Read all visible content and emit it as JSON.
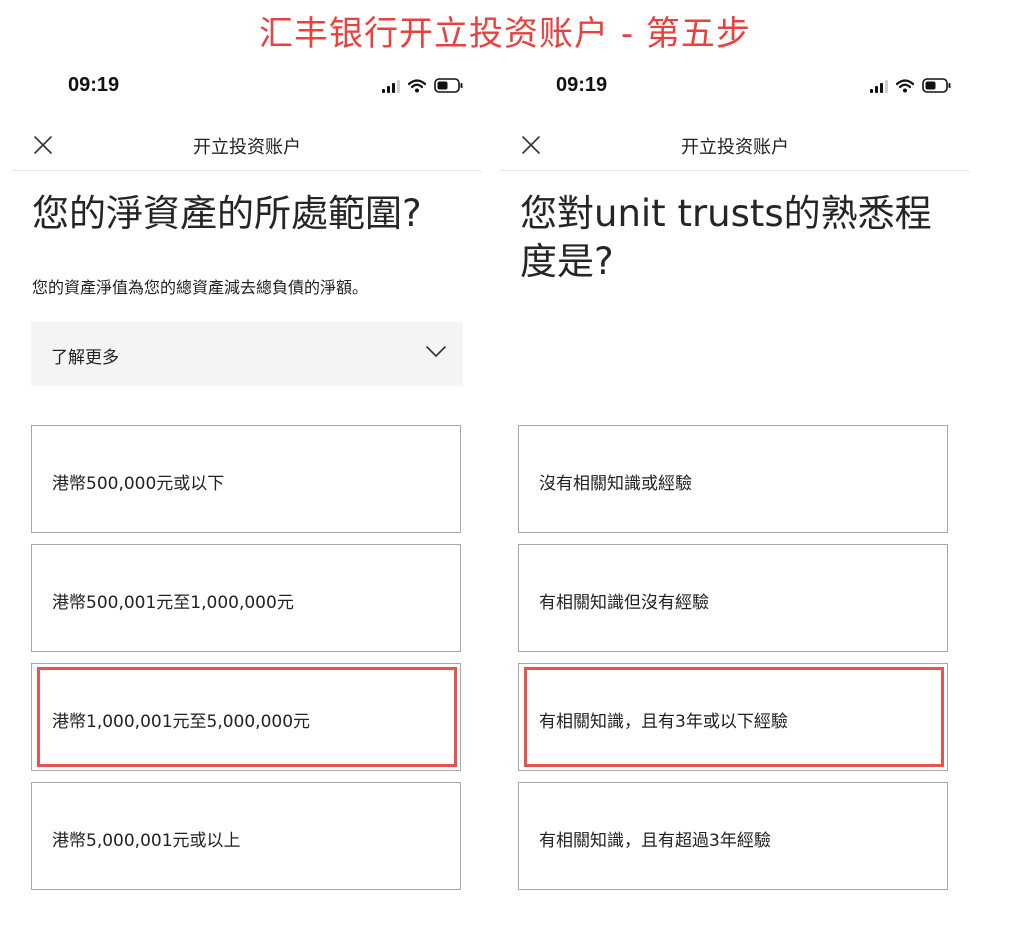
{
  "banner": {
    "title": "汇丰银行开立投资账户 - 第五步"
  },
  "colors": {
    "highlight": "#e8534f",
    "banner": "#e8413e",
    "learn_more_bg": "#f4f4f4"
  },
  "screens": [
    {
      "status": {
        "time": "09:19"
      },
      "nav": {
        "title": "开立投资账户",
        "close_icon": "close-icon"
      },
      "question": "您的淨資產的所處範圍?",
      "subtext": "您的資產淨值為您的總資產減去總負債的淨額。",
      "learn_more": {
        "label": "了解更多",
        "icon": "chevron-down-icon"
      },
      "options": [
        {
          "label": "港幣500,000元或以下",
          "highlighted": false
        },
        {
          "label": "港幣500,001元至1,000,000元",
          "highlighted": false
        },
        {
          "label": "港幣1,000,001元至5,000,000元",
          "highlighted": true
        },
        {
          "label": "港幣5,000,001元或以上",
          "highlighted": false
        }
      ]
    },
    {
      "status": {
        "time": "09:19"
      },
      "nav": {
        "title": "开立投资账户",
        "close_icon": "close-icon"
      },
      "question": "您對unit trusts的熟悉程度是?",
      "options": [
        {
          "label": "沒有相關知識或經驗",
          "highlighted": false
        },
        {
          "label": "有相關知識但沒有經驗",
          "highlighted": false
        },
        {
          "label": "有相關知識，且有3年或以下經驗",
          "highlighted": true
        },
        {
          "label": "有相關知識，且有超過3年經驗",
          "highlighted": false
        }
      ]
    }
  ]
}
